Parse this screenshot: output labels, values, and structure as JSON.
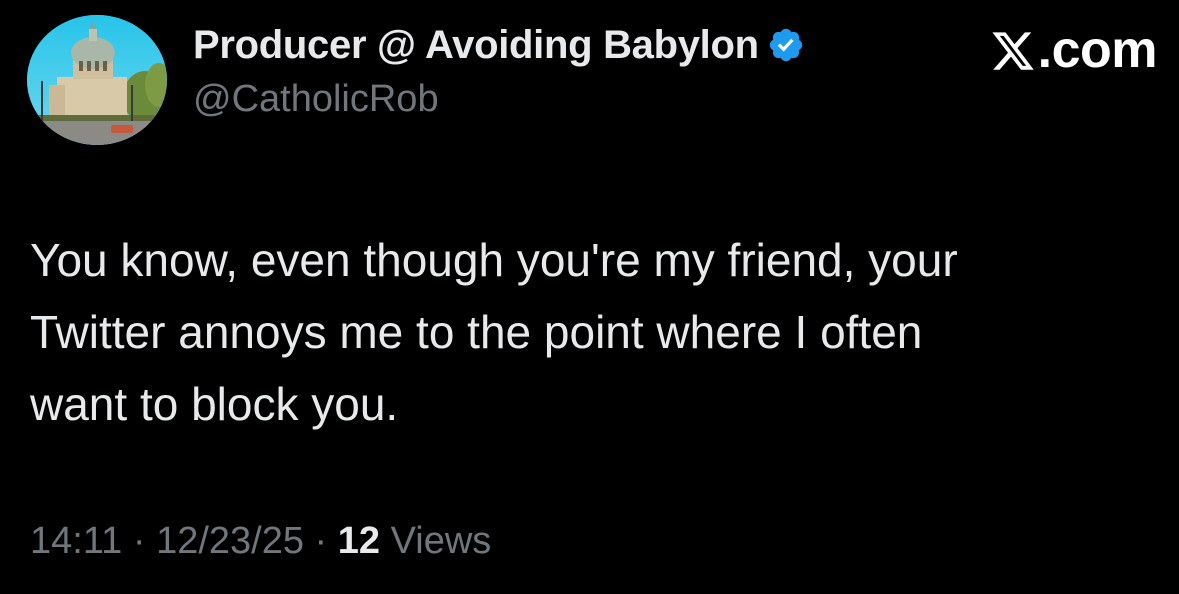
{
  "author": {
    "display_name": "Producer @ Avoiding Babylon",
    "handle": "@CatholicRob",
    "verified_icon": "verified-badge-icon",
    "avatar_icon": "cathedral-avatar"
  },
  "brand": {
    "label": ".com",
    "logo_icon": "x-logo-icon"
  },
  "tweet": {
    "text": "You know, even though you're my friend, your\nTwitter annoys me to the point where I often\nwant to block you.",
    "time": "14:11",
    "sep1": " · ",
    "date": "12/23/25",
    "sep2": " · ",
    "views_count": "12",
    "views_label": " Views"
  },
  "colors": {
    "background": "#000000",
    "primary_text": "#e7e9ea",
    "secondary_text": "#71767b",
    "verified_blue": "#1d9bf0"
  }
}
